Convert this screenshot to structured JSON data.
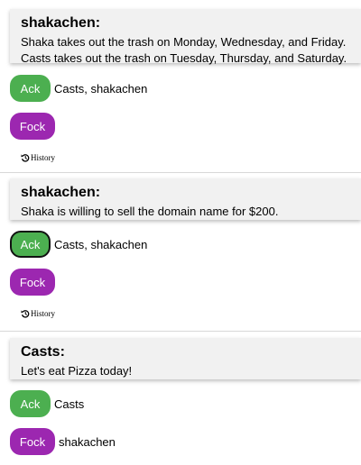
{
  "posts": [
    {
      "author": "shakachen:",
      "message": [
        "Shaka takes out the trash on Monday, Wednesday, and Friday.",
        "Casts takes out the trash on Tuesday, Thursday, and Saturday."
      ],
      "ack_label": "Ack",
      "ack_users": "Casts, shakachen",
      "fock_label": "Fock",
      "fock_users": "",
      "history_label": "History"
    },
    {
      "author": "shakachen:",
      "message": [
        "Shaka is willing to sell the domain name for $200."
      ],
      "ack_label": "Ack",
      "ack_users": "Casts, shakachen",
      "fock_label": "Fock",
      "fock_users": "",
      "history_label": "History"
    },
    {
      "author": "Casts:",
      "message": [
        "Let's eat Pizza today!"
      ],
      "ack_label": "Ack",
      "ack_users": "Casts",
      "fock_label": "Fock",
      "fock_users": "shakachen"
    }
  ],
  "colors": {
    "ack": "#4caf50",
    "fock": "#9c27b0",
    "card": "#f1f1f1"
  }
}
